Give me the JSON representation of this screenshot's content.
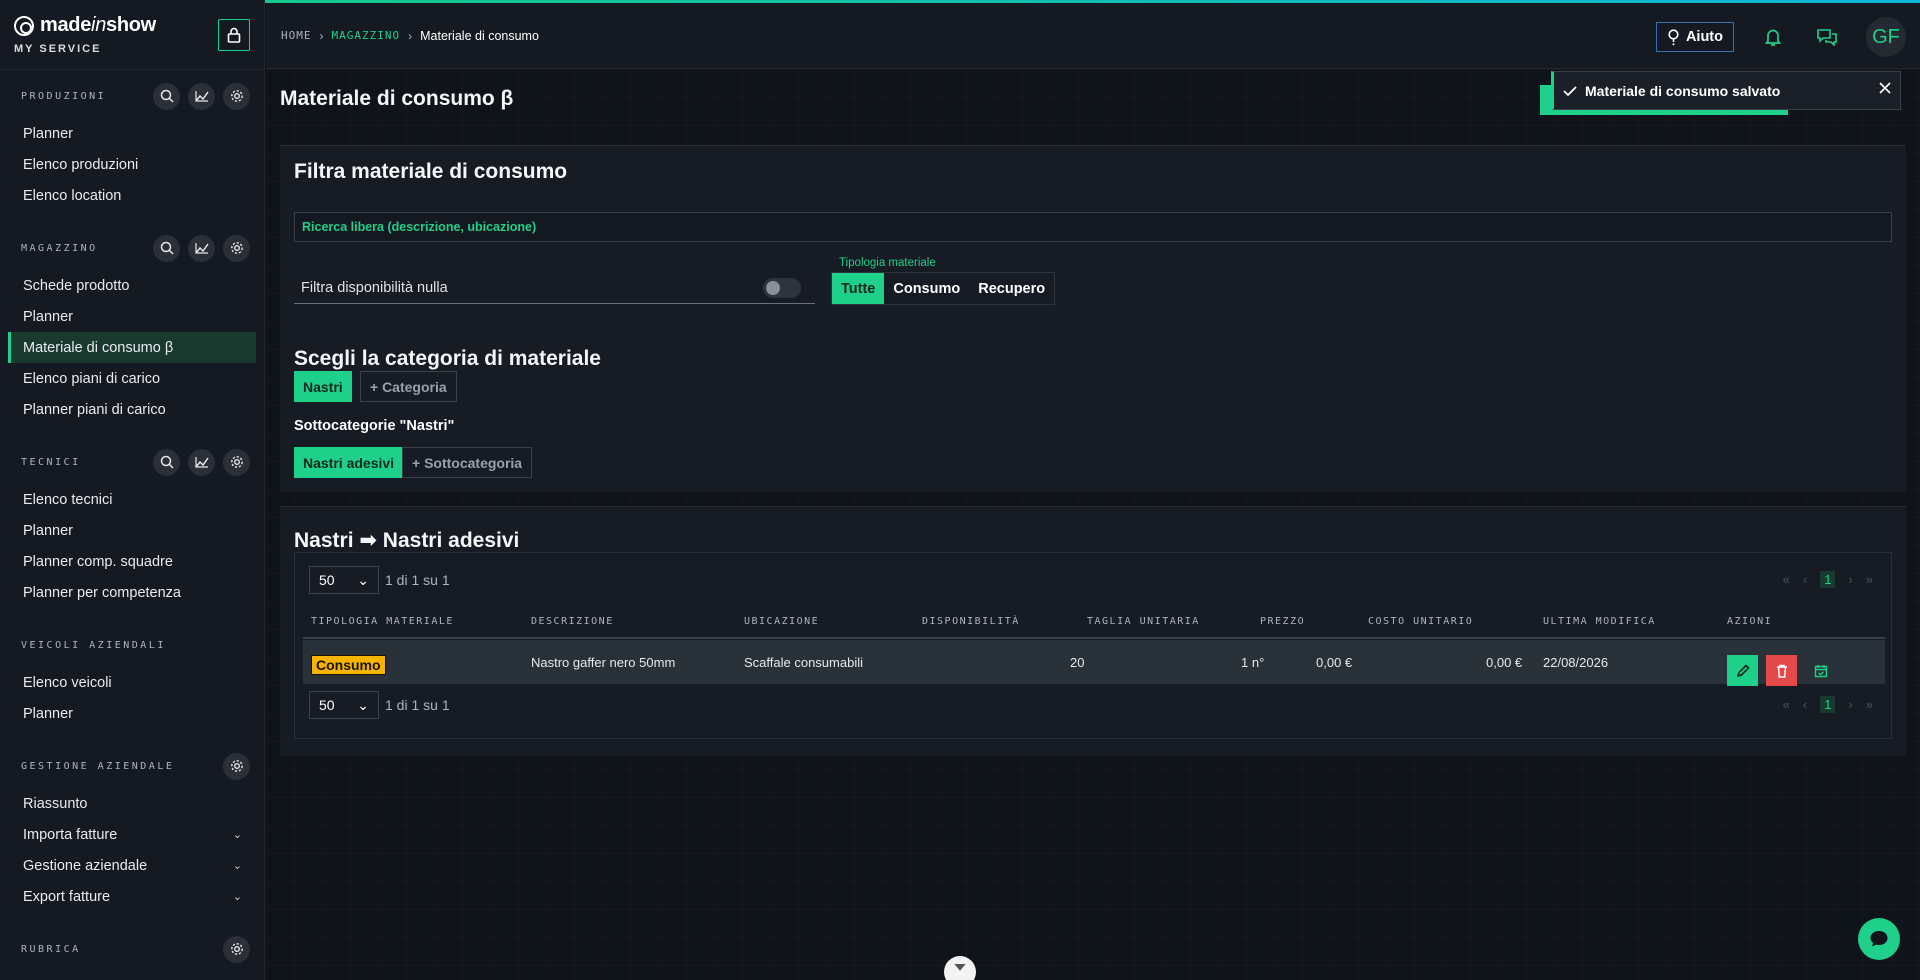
{
  "brand": {
    "name_part1": "made",
    "name_part2": "in",
    "name_part3": "show",
    "subtitle": "MY SERVICE"
  },
  "sidebar": {
    "sections": [
      {
        "title": "PRODUZIONI",
        "items": [
          "Planner",
          "Elenco produzioni",
          "Elenco location"
        ]
      },
      {
        "title": "MAGAZZINO",
        "items": [
          "Schede prodotto",
          "Planner",
          "Materiale di consumo β",
          "Elenco piani di carico",
          "Planner piani di carico"
        ],
        "active": "Materiale di consumo β"
      },
      {
        "title": "TECNICI",
        "items": [
          "Elenco tecnici",
          "Planner",
          "Planner comp. squadre",
          "Planner per competenza"
        ]
      },
      {
        "title": "VEICOLI AZIENDALI",
        "items": [
          "Elenco veicoli",
          "Planner"
        ]
      },
      {
        "title": "GESTIONE AZIENDALE",
        "items": [
          "Riassunto",
          "Importa fatture",
          "Gestione aziendale",
          "Export fatture"
        ]
      },
      {
        "title": "RUBRICA",
        "items": []
      }
    ]
  },
  "breadcrumb": {
    "home": "HOME",
    "section": "MAGAZZINO",
    "current": "Materiale di consumo"
  },
  "topbar": {
    "help_label": "Aiuto",
    "avatar_initials": "GF"
  },
  "page": {
    "title": "Materiale di consumo β"
  },
  "filter": {
    "title": "Filtra materiale di consumo",
    "search_placeholder": "Ricerca libera (descrizione, ubicazione)",
    "null_availability_label": "Filtra disponibilità nulla",
    "type_label": "Tipologia materiale",
    "type_options": [
      "Tutte",
      "Consumo",
      "Recupero"
    ],
    "type_selected": "Tutte",
    "category_title": "Scegli la categoria di materiale",
    "category": "Nastri",
    "add_category": "+ Categoria",
    "subcategory_title": "Sottocategorie \"Nastri\"",
    "subcategory": "Nastri adesivi",
    "add_subcategory": "+ Sottocategoria"
  },
  "results": {
    "title": "Nastri ➡ Nastri adesivi",
    "page_size": "50",
    "count_text": "1 di 1 su 1",
    "current_page": "1",
    "columns": [
      "TIPOLOGIA MATERIALE",
      "DESCRIZIONE",
      "UBICAZIONE",
      "DISPONIBILITÀ",
      "TAGLIA UNITARIA",
      "PREZZO",
      "COSTO UNITARIO",
      "ULTIMA MODIFICA",
      "AZIONI"
    ],
    "rows": [
      {
        "tipologia": "Consumo",
        "descrizione": "Nastro gaffer nero 50mm",
        "ubicazione": "Scaffale consumabili",
        "disponibilita": "20",
        "taglia": "1 n°",
        "prezzo": "0,00 €",
        "costo": "0,00 €",
        "modifica": "22/08/2026"
      }
    ]
  },
  "toast": {
    "message": "Materiale di consumo salvato"
  },
  "colors": {
    "accent": "#1fd08a",
    "warning": "#f5b400",
    "danger": "#e54848",
    "background": "#0f131a",
    "panel": "#171b23"
  },
  "icons": [
    "lock-icon",
    "search-icon",
    "chart-icon",
    "gear-icon",
    "help-icon",
    "bell-icon",
    "chat-icon",
    "pencil-icon",
    "trash-icon",
    "calendar-check-icon",
    "check-icon",
    "close-icon",
    "chevron-down-icon"
  ]
}
